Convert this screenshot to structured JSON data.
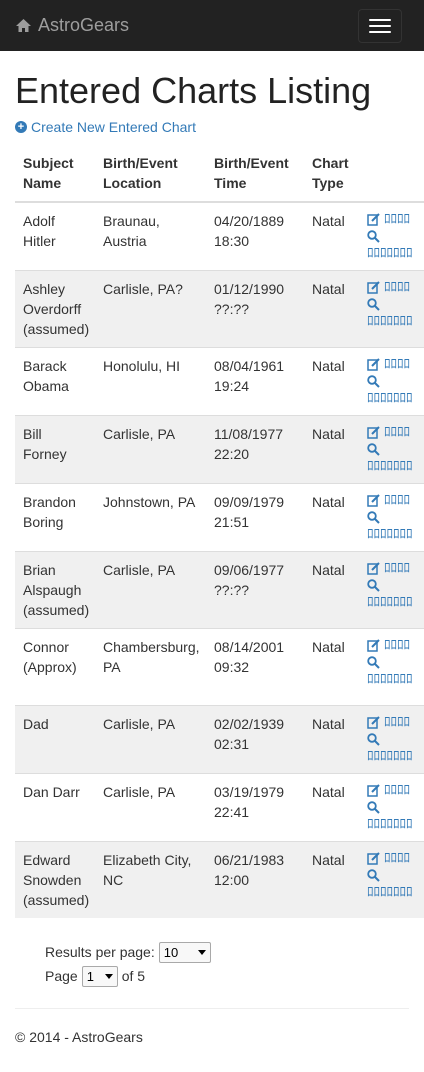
{
  "navbar": {
    "brand": "AstroGears",
    "icon": "home-icon",
    "menu_icon": "hamburger-icon"
  },
  "page": {
    "title": "Entered Charts Listing",
    "create_link": "Create New Entered Chart"
  },
  "table": {
    "headers": [
      "Subject Name",
      "Birth/Event Location",
      "Birth/Event Time",
      "Chart Type"
    ],
    "rows": [
      {
        "name": "Adolf Hitler",
        "location": "Braunau, Austria",
        "time": "04/20/1889 18:30",
        "type": "Natal",
        "edit": "ﾛﾛﾛﾛ",
        "view": "ﾛﾛﾛﾛﾛﾛﾛ"
      },
      {
        "name": "Ashley Overdorff (assumed)",
        "location": "Carlisle, PA?",
        "time": "01/12/1990 ??:??",
        "type": "Natal",
        "edit": "ﾛﾛﾛﾛ",
        "view": "ﾛﾛﾛﾛﾛﾛﾛ"
      },
      {
        "name": "Barack Obama",
        "location": "Honolulu, HI",
        "time": "08/04/1961 19:24",
        "type": "Natal",
        "edit": "ﾛﾛﾛﾛ",
        "view": "ﾛﾛﾛﾛﾛﾛﾛ"
      },
      {
        "name": "Bill Forney",
        "location": "Carlisle, PA",
        "time": "11/08/1977 22:20",
        "type": "Natal",
        "edit": "ﾛﾛﾛﾛ",
        "view": "ﾛﾛﾛﾛﾛﾛﾛ"
      },
      {
        "name": "Brandon Boring",
        "location": "Johnstown, PA",
        "time": "09/09/1979 21:51",
        "type": "Natal",
        "edit": "ﾛﾛﾛﾛ",
        "view": "ﾛﾛﾛﾛﾛﾛﾛ"
      },
      {
        "name": "Brian Alspaugh (assumed)",
        "location": "Carlisle, PA",
        "time": "09/06/1977 ??:??",
        "type": "Natal",
        "edit": "ﾛﾛﾛﾛ",
        "view": "ﾛﾛﾛﾛﾛﾛﾛ"
      },
      {
        "name": "Connor (Approx)",
        "location": "Chambersburg, PA",
        "time": "08/14/2001 09:32",
        "type": "Natal",
        "edit": "ﾛﾛﾛﾛ",
        "view": "ﾛﾛﾛﾛﾛﾛﾛ"
      },
      {
        "name": "Dad",
        "location": "Carlisle, PA",
        "time": "02/02/1939 02:31",
        "type": "Natal",
        "edit": "ﾛﾛﾛﾛ",
        "view": "ﾛﾛﾛﾛﾛﾛﾛ"
      },
      {
        "name": "Dan Darr",
        "location": "Carlisle, PA",
        "time": "03/19/1979 22:41",
        "type": "Natal",
        "edit": "ﾛﾛﾛﾛ",
        "view": "ﾛﾛﾛﾛﾛﾛﾛ"
      },
      {
        "name": "Edward Snowden (assumed)",
        "location": "Elizabeth City, NC",
        "time": "06/21/1983 12:00",
        "type": "Natal",
        "edit": "ﾛﾛﾛﾛ",
        "view": "ﾛﾛﾛﾛﾛﾛﾛ"
      }
    ]
  },
  "pagination": {
    "results_label": "Results per page:",
    "results_value": "10",
    "page_label": "Page",
    "page_value": "1",
    "of_label": "of 5"
  },
  "footer": {
    "text": "© 2014 - AstroGears"
  },
  "colors": {
    "link": "#337ab7",
    "navbar": "#222222",
    "stripe": "#f0f0f0"
  }
}
